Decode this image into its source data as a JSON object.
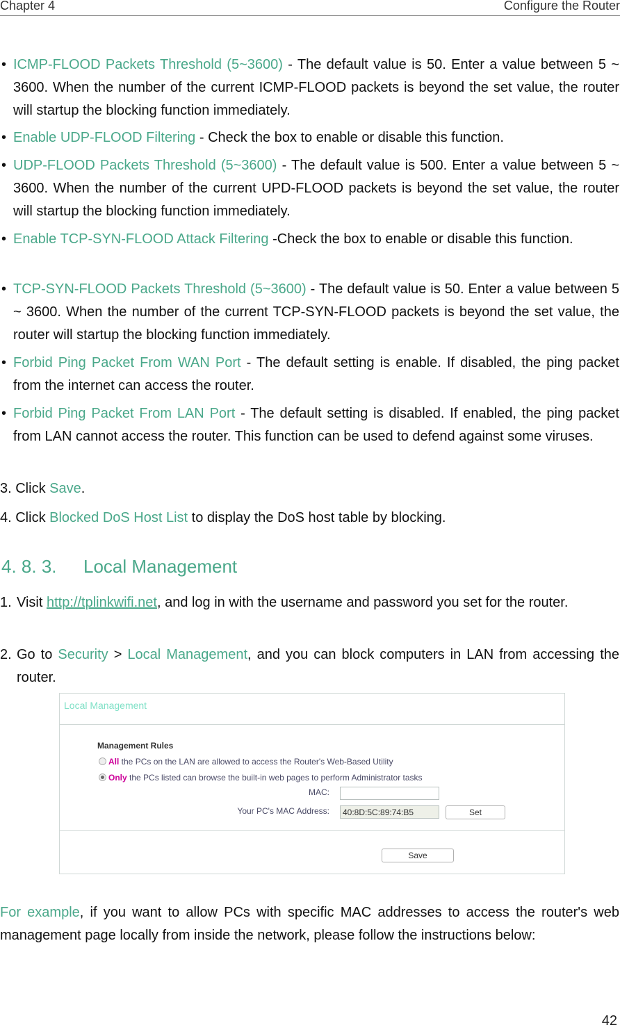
{
  "header": {
    "chapter": "Chapter 4",
    "section": "Configure the Router"
  },
  "bullets": [
    {
      "term": "ICMP-FLOOD Packets Threshold (5~3600)",
      "text": " - The default value is 50. Enter a value between 5 ~ 3600. When the number of the current ICMP-FLOOD packets is beyond the set value, the router will startup the blocking function immediately."
    },
    {
      "term": "Enable UDP-FLOOD Filtering",
      "text": " - Check the box to enable or disable this function."
    },
    {
      "term": "UDP-FLOOD Packets Threshold (5~3600)",
      "text": " - The default value is 500. Enter a value between 5 ~ 3600. When the number of the current UPD-FLOOD packets is beyond the set value, the router will startup the blocking function immediately."
    },
    {
      "term": "Enable TCP-SYN-FLOOD Attack Filtering",
      "text": " -Check the box to enable or disable this function."
    },
    {
      "term": "TCP-SYN-FLOOD Packets Threshold (5~3600)",
      "text": " - The default value is 50. Enter a value between 5 ~ 3600. When the number of the current TCP-SYN-FLOOD packets is beyond the set value, the router will startup the blocking function immediately."
    },
    {
      "term": "Forbid Ping Packet From WAN Port",
      "text": " - The default setting is enable. If disabled, the ping packet from the internet can access the router."
    },
    {
      "term": "Forbid Ping Packet From LAN Port",
      "text": " - The default setting is disabled. If enabled, the ping packet from LAN cannot access the router. This function can be used to defend against some viruses."
    }
  ],
  "steps_a": [
    {
      "prefix": "3. Click ",
      "term": "Save",
      "suffix": "."
    },
    {
      "prefix": "4. Click ",
      "term": "Blocked DoS Host List",
      "suffix": " to display the DoS host table by blocking."
    }
  ],
  "section": {
    "number": "4. 8. 3.",
    "title": "Local Management"
  },
  "steps_b": {
    "s1": {
      "n": "1.",
      "prefix": "Visit ",
      "link": "http://tplinkwifi.net",
      "suffix": ", and log in with the username and password you set for the router."
    },
    "s2": {
      "n": "2.",
      "prefix": "Go to ",
      "term1": "Security",
      "sep": " > ",
      "term2": "Local Management",
      "suffix": ", and you can block computers in LAN from accessing the router."
    }
  },
  "panel": {
    "title": "Local Management",
    "rules_label": "Management Rules",
    "radio_all": {
      "em": "All",
      "text": " the PCs on the LAN are allowed to access the Router's Web-Based Utility",
      "selected": false
    },
    "radio_only": {
      "em": "Only",
      "text": " the PCs listed can browse the built-in web pages to perform Administrator tasks",
      "selected": true
    },
    "mac_label": "MAC:",
    "mac_value": "",
    "pc_mac_label": "Your PC's MAC Address:",
    "pc_mac_value": "40:8D:5C:89:74:B5",
    "set_label": "Set",
    "save_label": "Save"
  },
  "example": {
    "term": "For example",
    "text": ", if you want to allow PCs with specific MAC addresses to access the router's web management page locally from inside the network, please follow the instructions below:"
  },
  "page_number": "42",
  "colors": {
    "accent": "#4aa88a",
    "panel_title": "#7ee0c6",
    "emphasis": "#cc0099"
  }
}
